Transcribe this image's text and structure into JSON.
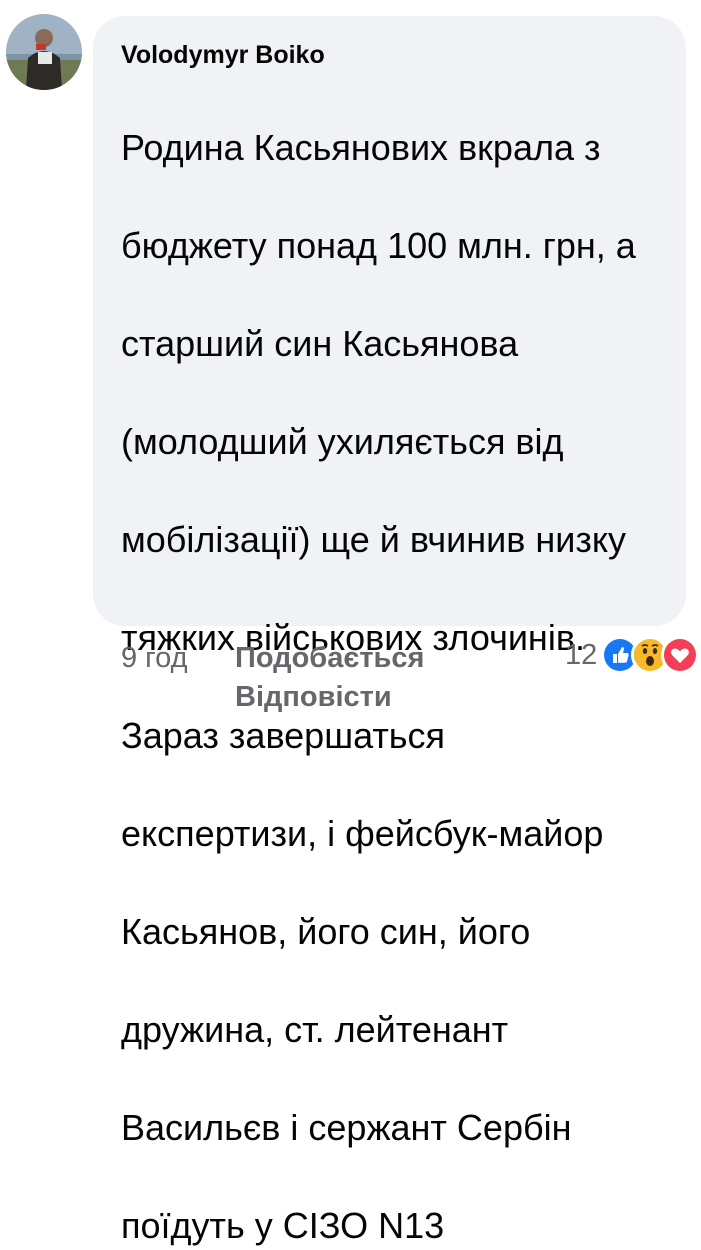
{
  "comment": {
    "author": "Volodymyr Boiko",
    "text_lines": [
      "Родина Касьянових вкрала з",
      "бюджету понад 100 млн. грн, а",
      "старший син Касьянова",
      "(молодший ухиляється від",
      "мобілізації) ще й вчинив низку",
      "тяжких військових злочинів.",
      "Зараз завершаться",
      "експертизи, і фейсбук-майор",
      "Касьянов, його син, його",
      "дружина, ст. лейтенант",
      "Васильєв і сержант Сербін",
      "поїдуть у СІЗО N13"
    ],
    "time": "9 год",
    "like_label": "Подобається",
    "reply_label": "Відповісти",
    "reaction_count": "12",
    "reactions": [
      "like-icon",
      "wow-icon",
      "love-icon"
    ]
  },
  "colors": {
    "bubble": "#f0f2f5",
    "text": "#050505",
    "meta": "#65676b",
    "like": "#1877f2",
    "love": "#f33e58",
    "wow": "#f7b928"
  }
}
